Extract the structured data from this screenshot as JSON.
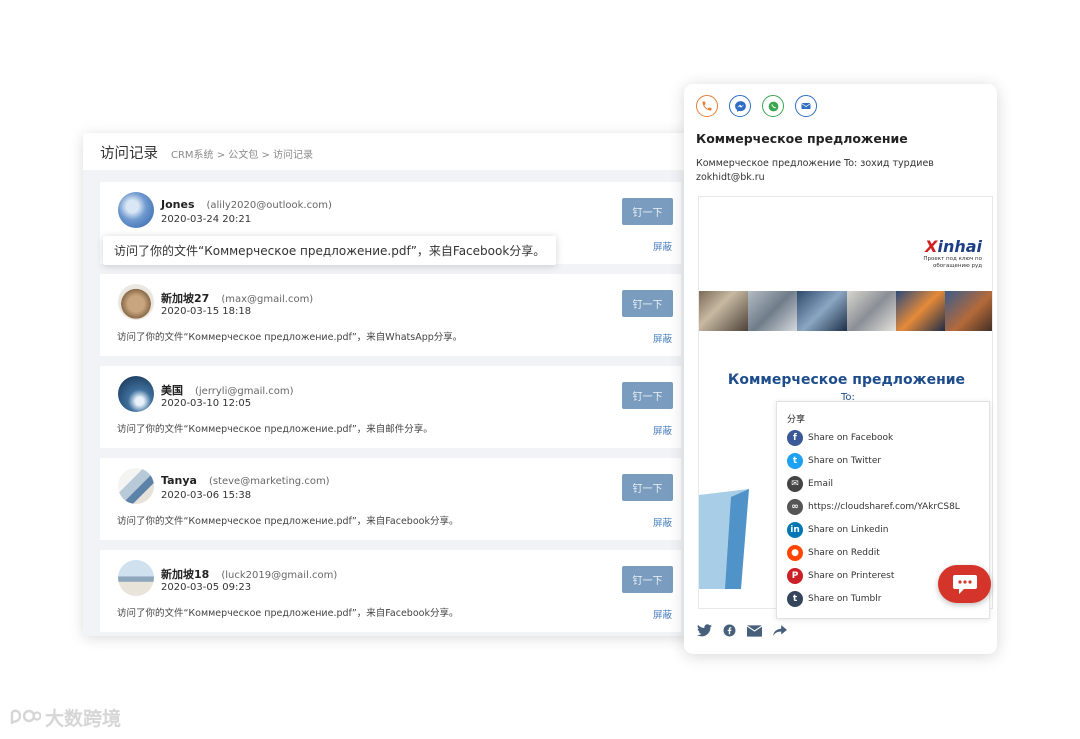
{
  "crm": {
    "title": "访问记录",
    "breadcrumb": "CRM系统 > 公文包 > 访问记录",
    "ding_label": "钉一下",
    "block_label": "屏蔽",
    "records": [
      {
        "name": "Jones",
        "email": "(alily2020@outlook.com)",
        "date": "2020-03-24  20:21",
        "message": "访问了你的文件“Коммерческое предложение.pdf”，来自Facebook分享。"
      },
      {
        "name": "新加坡27",
        "email": "(max@gmail.com)",
        "date": "2020-03-15  18:18",
        "message": "访问了你的文件“Коммерческое предложение.pdf”，来自WhatsApp分享。"
      },
      {
        "name": "美国",
        "email": "(jerryli@gmail.com)",
        "date": "2020-03-10  12:05",
        "message": "访问了你的文件“Коммерческое предложение.pdf”，来自邮件分享。"
      },
      {
        "name": "Tanya",
        "email": "(steve@marketing.com)",
        "date": "2020-03-06  15:38",
        "message": "访问了你的文件“Коммерческое предложение.pdf”，来自Facebook分享。"
      },
      {
        "name": "新加坡18",
        "email": "(luck2019@gmail.com)",
        "date": "2020-03-05  09:23",
        "message": "访问了你的文件“Коммерческое предложение.pdf”，来自Facebook分享。"
      }
    ]
  },
  "mobile": {
    "contact_icons": [
      "phone-icon",
      "messenger-icon",
      "whatsapp-icon",
      "email-icon"
    ],
    "title": "Коммерческое предложение",
    "subtitle": "Коммерческое предложение To: зохид турдиев zokhidt@bk.ru",
    "document": {
      "logo_x": "X",
      "logo_rest": "inhai",
      "tagline_1": "Проект под ключ по",
      "tagline_2": "обогащению руд",
      "title": "Коммерческое предложение",
      "to": "To:"
    },
    "share": {
      "title": "分享",
      "items": [
        {
          "label": "Share on Facebook",
          "icon": "facebook-icon",
          "color": "#3b5998",
          "glyph": "f"
        },
        {
          "label": "Share on Twitter",
          "icon": "twitter-icon",
          "color": "#1da1f2",
          "glyph": "t"
        },
        {
          "label": "Email",
          "icon": "email-icon",
          "color": "#444444",
          "glyph": "✉"
        },
        {
          "label": "https://cloudsharef.com/YAkrCS8L",
          "icon": "link-icon",
          "color": "#555555",
          "glyph": "∞"
        },
        {
          "label": "Share on Linkedin",
          "icon": "linkedin-icon",
          "color": "#0077b5",
          "glyph": "in"
        },
        {
          "label": "Share on Reddit",
          "icon": "reddit-icon",
          "color": "#ff4500",
          "glyph": "●"
        },
        {
          "label": "Share on Printerest",
          "icon": "pinterest-icon",
          "color": "#cb2027",
          "glyph": "P"
        },
        {
          "label": "Share on Tumblr",
          "icon": "tumblr-icon",
          "color": "#35465c",
          "glyph": "t"
        }
      ]
    },
    "bottom_icons": [
      "twitter-icon",
      "facebook-icon",
      "email-icon",
      "share-icon"
    ]
  },
  "watermark": "大数跨境",
  "colors": {
    "ding_button": "#7a9dbf",
    "link_blue": "#4a7fc1",
    "chat_red": "#d5342b",
    "doc_blue": "#1d4d8c"
  }
}
